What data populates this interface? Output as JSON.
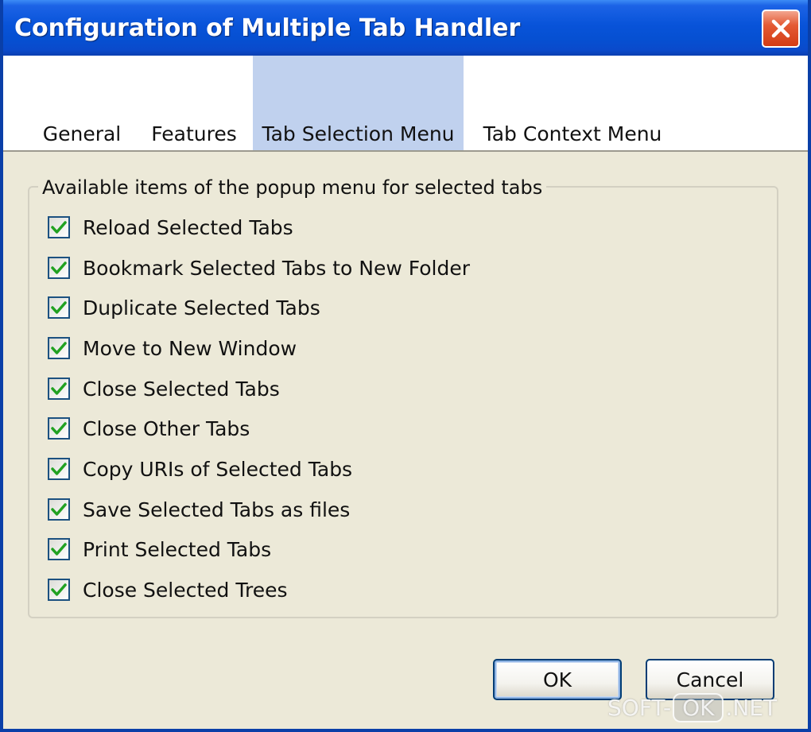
{
  "window": {
    "title": "Configuration of Multiple Tab Handler",
    "close_icon": "close-icon"
  },
  "tabs": [
    {
      "label": "General",
      "active": false
    },
    {
      "label": "Features",
      "active": false
    },
    {
      "label": "Tab Selection Menu",
      "active": true
    },
    {
      "label": "Tab Context Menu",
      "active": false
    }
  ],
  "group": {
    "legend": "Available items of the popup menu for selected tabs",
    "items": [
      {
        "label": "Reload Selected Tabs",
        "checked": true
      },
      {
        "label": "Bookmark Selected Tabs to New Folder",
        "checked": true
      },
      {
        "label": "Duplicate Selected Tabs",
        "checked": true
      },
      {
        "label": "Move to New Window",
        "checked": true
      },
      {
        "label": "Close Selected Tabs",
        "checked": true
      },
      {
        "label": "Close Other Tabs",
        "checked": true
      },
      {
        "label": "Copy URIs of Selected Tabs",
        "checked": true
      },
      {
        "label": "Save Selected Tabs as files",
        "checked": true
      },
      {
        "label": "Print Selected Tabs",
        "checked": true
      },
      {
        "label": "Close Selected Trees",
        "checked": true
      }
    ]
  },
  "buttons": {
    "ok": "OK",
    "cancel": "Cancel"
  },
  "watermark": {
    "left": "SOFT-",
    "middle": "OK",
    "right": ".NET"
  },
  "colors": {
    "titlebar": "#0853D9",
    "dialog_bg": "#ECE9D8",
    "active_tab": "#C0D1EE",
    "check": "#21A121",
    "close_button": "#D33C15"
  }
}
